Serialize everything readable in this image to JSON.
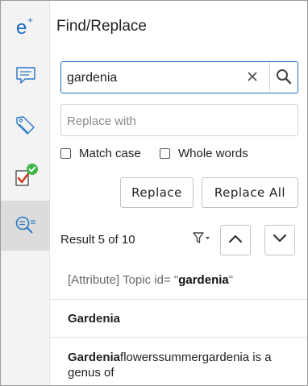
{
  "panel": {
    "title": "Find/Replace"
  },
  "rail": {
    "items": [
      {
        "icon": "edit-e-plus-icon",
        "accent": "#1e6cc2"
      },
      {
        "icon": "comment-icon"
      },
      {
        "icon": "tags-icon"
      },
      {
        "icon": "review-checked-icon",
        "badge_color": "#3fb54a",
        "check_color": "#d23a2a"
      },
      {
        "icon": "find-replace-icon",
        "active": true
      }
    ]
  },
  "search": {
    "value": "gardenia",
    "clear_icon": "close-icon",
    "search_icon": "search-icon",
    "border_color": "#1e6cc2"
  },
  "replace": {
    "placeholder": "Replace with",
    "value": ""
  },
  "options": {
    "match_case": "Match case",
    "whole_words": "Whole words"
  },
  "buttons": {
    "replace": "Replace",
    "replace_all": "Replace All"
  },
  "results": {
    "count_text": "Result 5 of 10",
    "filter_icon": "filter-icon",
    "prev_icon": "chevron-up-icon",
    "next_icon": "chevron-down-icon",
    "items": [
      {
        "prefix": "[Attribute] Topic id= \"",
        "match": "gardenia",
        "suffix": "\""
      },
      {
        "text": "Gardenia"
      },
      {
        "match": "Gardenia",
        "rest": "flowerssummergardenia is a genus of"
      }
    ]
  }
}
